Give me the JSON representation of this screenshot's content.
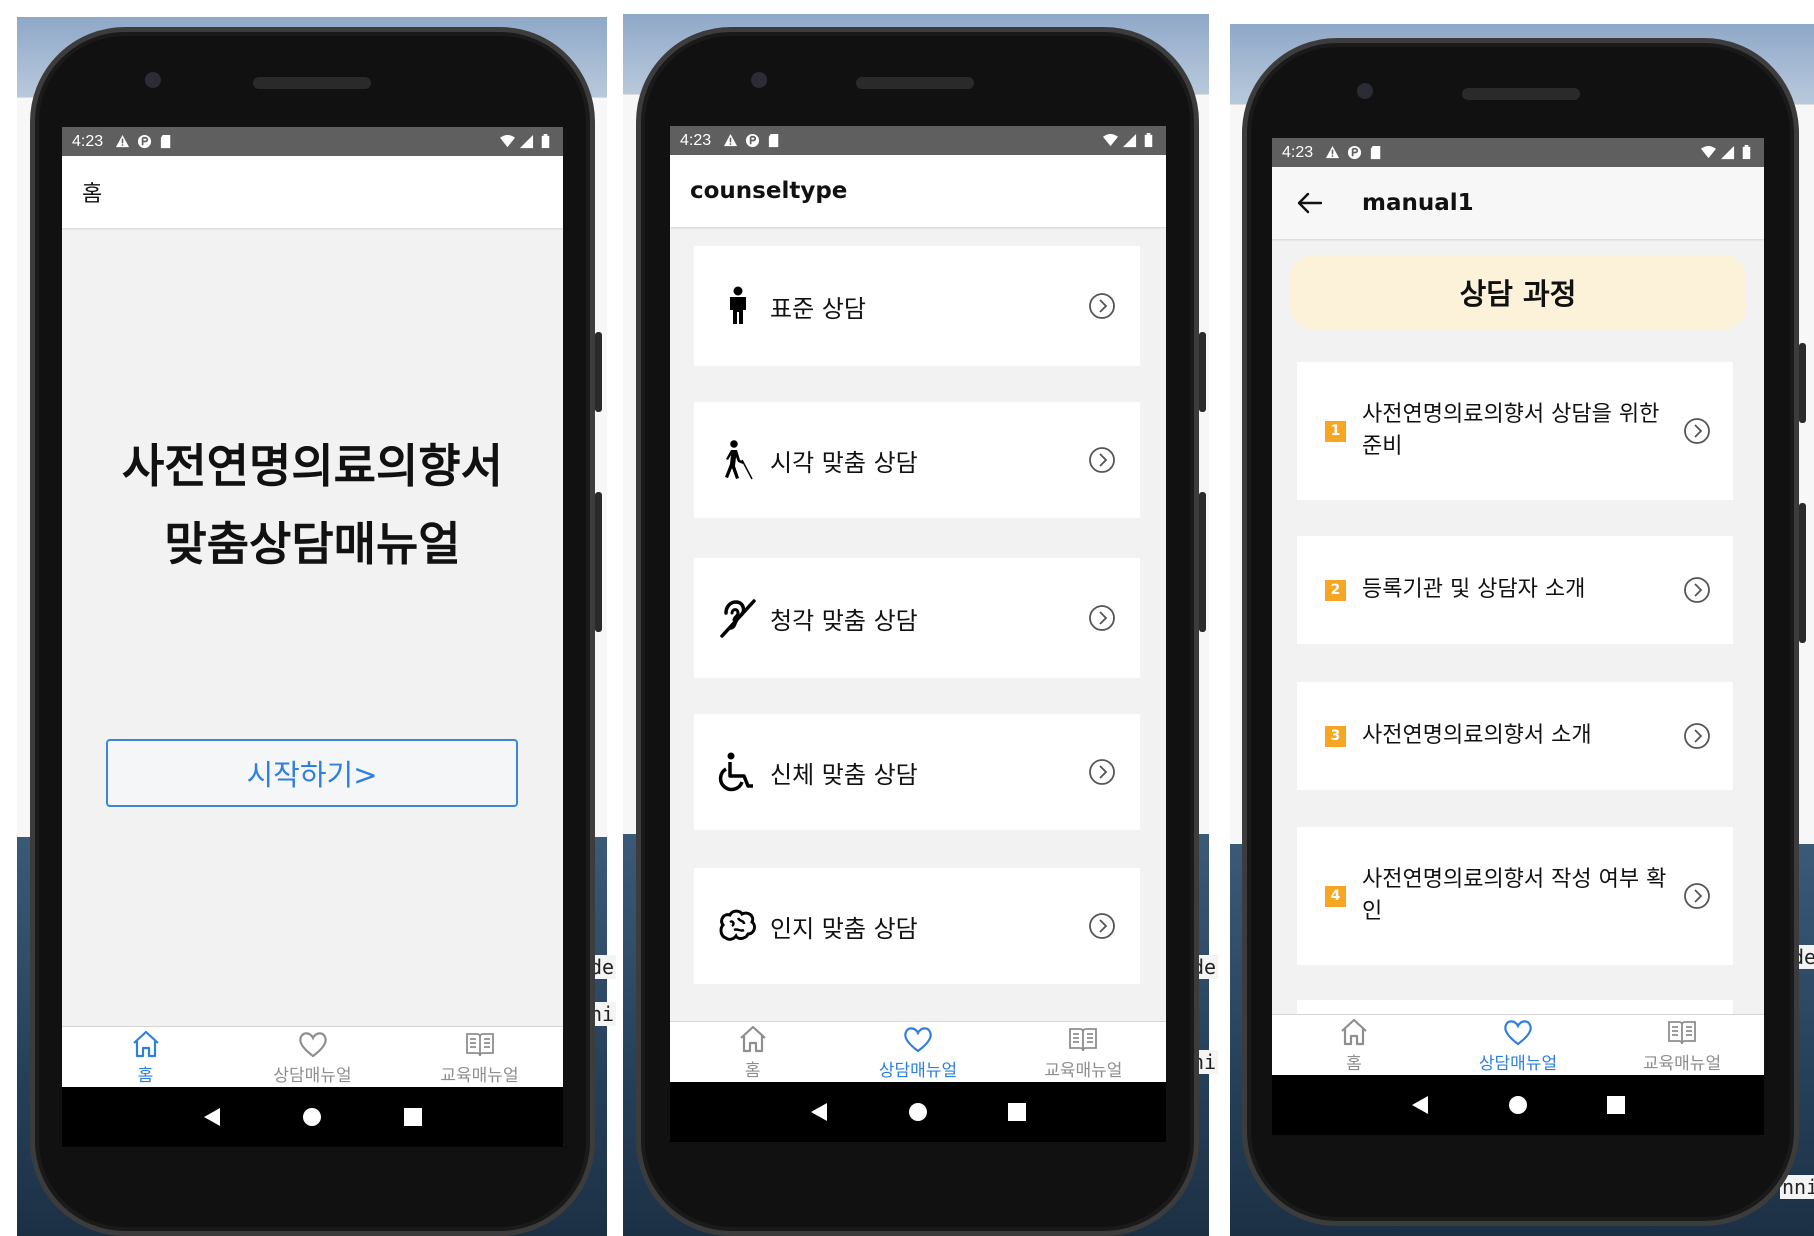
{
  "status": {
    "time": "4:23"
  },
  "tabs": {
    "home": "홈",
    "counsel": "상담매뉴얼",
    "education": "교육매뉴얼"
  },
  "colors": {
    "accent": "#2f7fe0",
    "badge": "#f6a623",
    "banner": "#fcf2d9"
  },
  "screen1": {
    "title": "홈",
    "hero_line1": "사전연명의료의향서",
    "hero_line2": "맞춤상담매뉴얼",
    "start_button": "시작하기>"
  },
  "screen2": {
    "title": "counseltype",
    "items": [
      {
        "label": "표준 상담",
        "icon": "person-icon"
      },
      {
        "label": "시각 맞춤 상담",
        "icon": "blind-walking-icon"
      },
      {
        "label": "청각 맞춤 상담",
        "icon": "hearing-impaired-icon"
      },
      {
        "label": "신체 맞춤 상담",
        "icon": "wheelchair-icon"
      },
      {
        "label": "인지 맞춤 상담",
        "icon": "brain-icon"
      }
    ]
  },
  "screen3": {
    "title": "manual1",
    "banner": "상담 과정",
    "items": [
      {
        "num": "1",
        "label": "사전연명의료의향서 상담을 위한 준비"
      },
      {
        "num": "2",
        "label": "등록기관 및 상담자 소개"
      },
      {
        "num": "3",
        "label": "사전연명의료의향서 소개"
      },
      {
        "num": "4",
        "label": "사전연명의료의향서 작성 여부 확인"
      }
    ]
  },
  "background_snippets": [
    "de",
    "ni",
    "de",
    "ni",
    "de",
    "nni"
  ]
}
